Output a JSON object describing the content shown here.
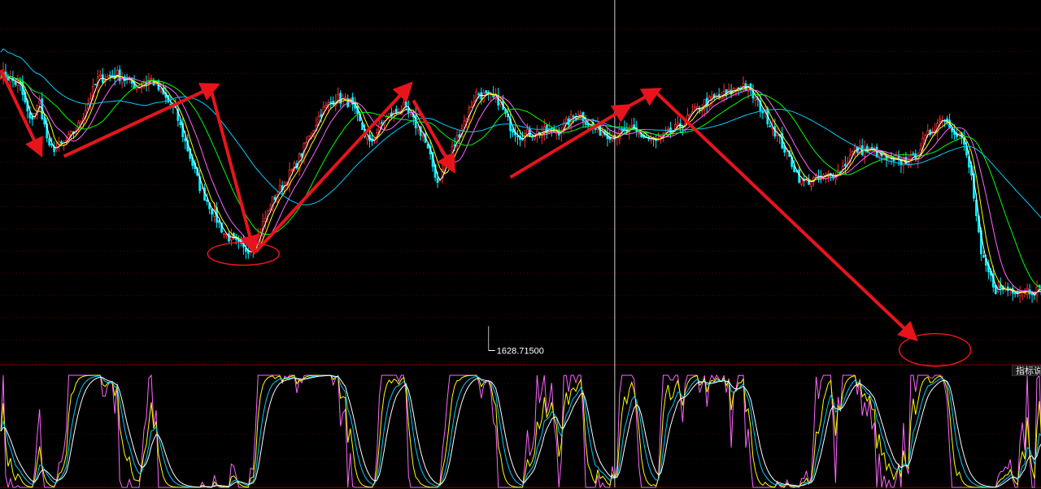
{
  "chart_data": {
    "type": "candlestick",
    "price_panel": {
      "ylim": [
        1600,
        2380
      ],
      "grid": "horizontal-dotted",
      "low_marker": {
        "label": "1628.71500",
        "index": 201,
        "value": 1628.715
      },
      "colors": {
        "up": "#ff3030",
        "down": "#00f0ff",
        "ma": [
          "#ffffff",
          "#ffff00",
          "#ff66ff",
          "#00ff00",
          "#00ccff"
        ]
      },
      "ohlc_keypoints": [
        [
          0,
          2225
        ],
        [
          8,
          2195
        ],
        [
          12,
          2120
        ],
        [
          16,
          2160
        ],
        [
          20,
          2060
        ],
        [
          26,
          2070
        ],
        [
          32,
          2110
        ],
        [
          40,
          2210
        ],
        [
          48,
          2220
        ],
        [
          56,
          2195
        ],
        [
          62,
          2210
        ],
        [
          72,
          2140
        ],
        [
          82,
          1980
        ],
        [
          92,
          1880
        ],
        [
          100,
          1845
        ],
        [
          104,
          1850
        ],
        [
          112,
          1950
        ],
        [
          122,
          2030
        ],
        [
          132,
          2140
        ],
        [
          138,
          2170
        ],
        [
          144,
          2160
        ],
        [
          152,
          2070
        ],
        [
          158,
          2125
        ],
        [
          166,
          2150
        ],
        [
          174,
          2090
        ],
        [
          180,
          1990
        ],
        [
          186,
          2060
        ],
        [
          196,
          2180
        ],
        [
          205,
          2165
        ],
        [
          210,
          2110
        ],
        [
          214,
          2090
        ],
        [
          220,
          2095
        ],
        [
          230,
          2100
        ],
        [
          238,
          2140
        ],
        [
          244,
          2105
        ],
        [
          252,
          2090
        ],
        [
          260,
          2100
        ],
        [
          270,
          2075
        ],
        [
          280,
          2110
        ],
        [
          290,
          2160
        ],
        [
          300,
          2180
        ],
        [
          306,
          2200
        ],
        [
          312,
          2160
        ],
        [
          320,
          2090
        ],
        [
          330,
          1990
        ],
        [
          340,
          2000
        ],
        [
          346,
          2015
        ],
        [
          352,
          2060
        ],
        [
          360,
          2055
        ],
        [
          368,
          2030
        ],
        [
          376,
          2040
        ],
        [
          382,
          2090
        ],
        [
          388,
          2130
        ],
        [
          396,
          2085
        ],
        [
          400,
          2000
        ],
        [
          404,
          1830
        ],
        [
          410,
          1760
        ],
        [
          418,
          1760
        ],
        [
          426,
          1758
        ]
      ]
    },
    "indicator_panel": {
      "ylim": [
        0,
        100
      ],
      "series_colors": [
        "#ff66ff",
        "#ffff00",
        "#00ccff",
        "#ffffff"
      ],
      "tab_label": "指标说"
    },
    "annotations": {
      "color": "#e8141c",
      "arrows": [
        {
          "from": [
            0,
            2230
          ],
          "to": [
            16,
            2055
          ]
        },
        {
          "from": [
            26,
            2045
          ],
          "to": [
            88,
            2195
          ]
        },
        {
          "from": [
            86,
            2200
          ],
          "to": [
            104,
            1847
          ]
        },
        {
          "from": [
            105,
            1840
          ],
          "to": [
            168,
            2195
          ]
        },
        {
          "from": [
            170,
            2165
          ],
          "to": [
            186,
            2020
          ]
        },
        {
          "from": [
            210,
            2000
          ],
          "to": [
            258,
            2150
          ]
        },
        {
          "from": [
            258,
            2150
          ],
          "to": [
            270,
            2185
          ]
        },
        {
          "from": [
            270,
            2182
          ],
          "to": [
            376,
            1658
          ]
        }
      ],
      "ellipses": [
        {
          "cx": 100,
          "cy": 1836
        },
        {
          "cx": 385,
          "cy": 1630
        }
      ]
    },
    "crosshair_index": 253
  }
}
